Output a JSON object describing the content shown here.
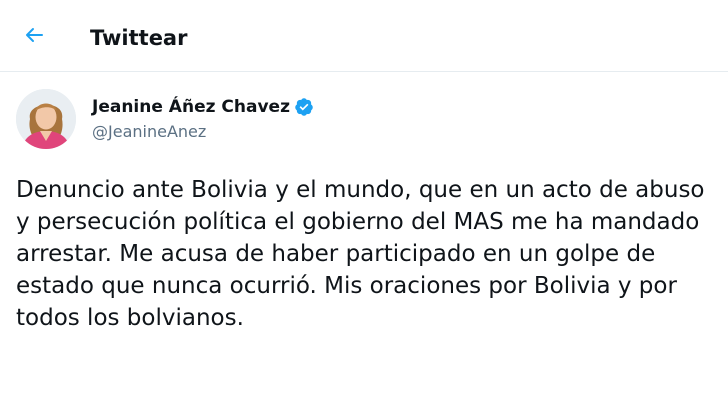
{
  "header": {
    "title": "Twittear",
    "back_icon": "arrow-left-icon",
    "accent_color": "#1da1f2"
  },
  "tweet": {
    "author": {
      "display_name": "Jeanine Áñez Chavez",
      "handle": "@JeanineAnez",
      "verified": true,
      "verified_icon": "verified-badge-icon",
      "verified_color": "#1da1f2"
    },
    "text": "Denuncio ante Bolivia y el mundo, que en un acto de abuso y persecución política el gobierno del MAS me ha mandado arrestar. Me acusa de haber participado en un golpe de estado que nunca ocurrió. Mis oraciones por Bolivia y por todos los bolvianos."
  }
}
